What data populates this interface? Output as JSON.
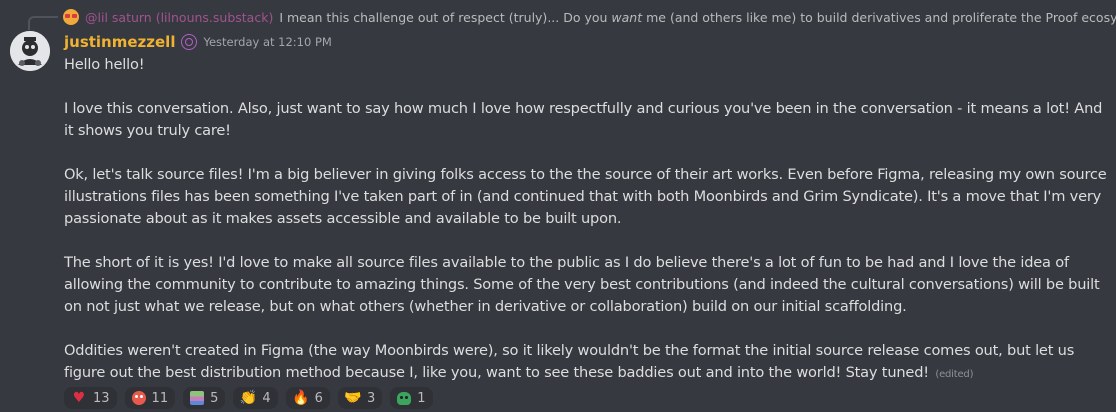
{
  "reply": {
    "author": "@lil saturn (lilnouns.substack)",
    "text_before": "I mean this challenge out of respect (truly)...  Do you ",
    "text_emphasis": "want",
    "text_after": " me (and others like me) to build derivatives and proliferate the Proof ecosystem for y'all..."
  },
  "message": {
    "author": "justinmezzell",
    "timestamp": "Yesterday at 12:10 PM",
    "paragraphs": [
      "Hello hello!",
      "I love this conversation. Also, just want to say how much I love how respectfully and curious you've been in the conversation - it means a lot! And it shows you truly care!",
      "Ok, let's talk source files! I'm a big believer in giving folks access to the the source of their art works. Even before Figma, releasing my own source illustrations files has been something I've taken part of in (and continued that with both Moonbirds and Grim Syndicate). It's a move that I'm very passionate about as it makes assets accessible and available to be built upon.",
      "The short of it is yes! I'd love to make all source files available to the public as I do believe there's a lot of fun to be had and I love the idea of allowing the community to contribute to amazing things. Some of the very best contributions (and indeed the cultural conversations) will be built on not just what we release, but on what others (whether in derivative or collaboration) build on our initial scaffolding.",
      "Oddities weren't created in Figma (the way Moonbirds were), so it likely wouldn't be the format the initial source release comes out, but let us figure out the best distribution method because I, like you, want to see these baddies out and into the world! Stay tuned!"
    ],
    "edited_label": "(edited)"
  },
  "reactions": [
    {
      "icon": "heart-icon",
      "glyph": "♥",
      "count": "13"
    },
    {
      "icon": "red-face-icon",
      "glyph": "",
      "count": "11"
    },
    {
      "icon": "pixel-sprite-icon",
      "glyph": "",
      "count": "5"
    },
    {
      "icon": "clapping-hands-icon",
      "glyph": "👏",
      "count": "4"
    },
    {
      "icon": "fire-icon",
      "glyph": "🔥",
      "count": "6"
    },
    {
      "icon": "handshake-icon",
      "glyph": "🤝",
      "count": "3"
    },
    {
      "icon": "green-skull-icon",
      "glyph": "",
      "count": "1"
    }
  ],
  "colors": {
    "background": "#36393f",
    "username": "#f0b232",
    "reply_author": "#b5579e",
    "text": "#dcddde",
    "muted": "#a3a6aa"
  }
}
